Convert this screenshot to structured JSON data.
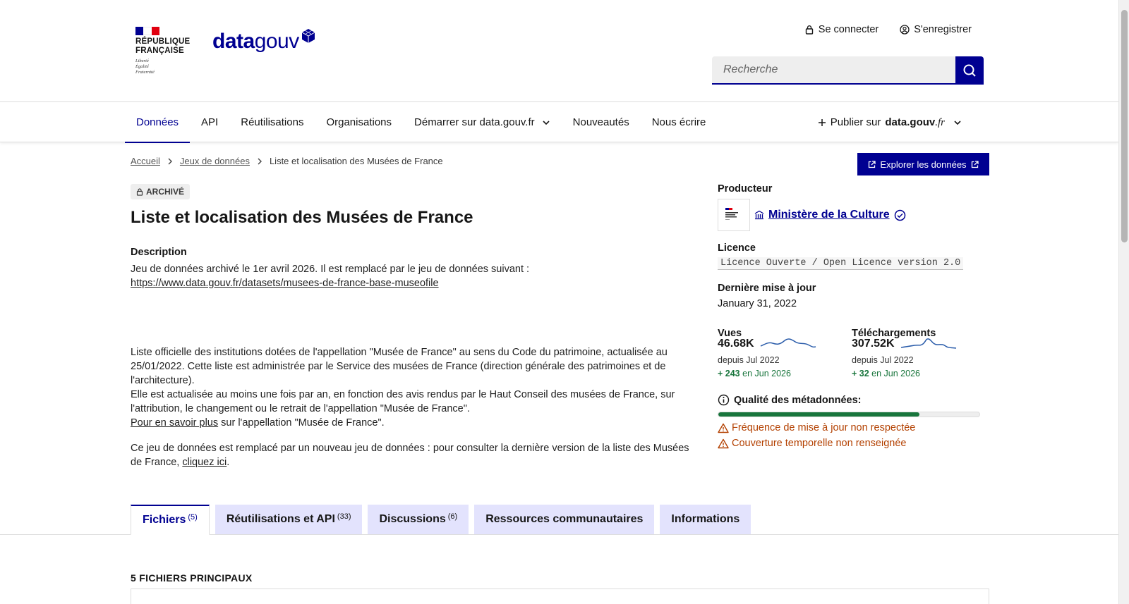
{
  "header": {
    "rf_name_line1": "RÉPUBLIQUE",
    "rf_name_line2": "FRANÇAISE",
    "rf_motto": [
      "Liberté",
      "Égalité",
      "Fraternité"
    ],
    "logo_bold": "data",
    "logo_light": "gouv",
    "login": "Se connecter",
    "register": "S'enregistrer",
    "search_placeholder": "Recherche"
  },
  "nav": {
    "items": [
      "Données",
      "API",
      "Réutilisations",
      "Organisations",
      "Démarrer sur data.gouv.fr",
      "Nouveautés",
      "Nous écrire"
    ],
    "publish_prefix": "Publier sur",
    "publish_bold": "data.gouv",
    "publish_suffix": ".fr"
  },
  "breadcrumb": {
    "home": "Accueil",
    "datasets": "Jeux de données",
    "current": "Liste et localisation des Musées de France"
  },
  "explore_button": "Explorer les données",
  "dataset": {
    "badge": "ARCHIVÉ",
    "title": "Liste et localisation des Musées de France",
    "description_label": "Description",
    "desc_line1": "Jeu de données archivé le 1er avril 2026. Il est remplacé par le jeu de données suivant :",
    "desc_link1": "https://www.data.gouv.fr/datasets/musees-de-france-base-museofile",
    "desc_para2": "Liste officielle des institutions dotées de l'appellation \"Musée de France\" au sens du Code du patrimoine, actualisée au 25/01/2022. Cette liste est administrée par le Service des musées de France (direction générale des patrimoines et de l'architecture).",
    "desc_para3": "Elle est actualisée au moins une fois par an, en fonction des avis rendus par le Haut Conseil des musées de France, sur l'attribution, le changement ou le retrait de l'appellation \"Musée de France\".",
    "desc_more_link": "Pour en savoir plus",
    "desc_more_rest": " sur l'appellation \"Musée de France\".",
    "desc_para4": "Ce jeu de données est remplacé par un nouveau jeu de données : pour consulter la dernière version de la liste des Musées de France, ",
    "desc_here_link": "cliquez ici",
    "desc_para4_end": "."
  },
  "sidebar": {
    "producer_label": "Producteur",
    "producer_name": "Ministère de la Culture",
    "license_label": "Licence",
    "license_value": "Licence Ouverte / Open Licence version 2.0",
    "updated_label": "Dernière mise à jour",
    "updated_value": "January 31, 2022",
    "views_label": "Vues",
    "views_value": "46.68K",
    "views_since": "depuis Jul 2022",
    "views_delta": "+ 243",
    "views_delta_period": " en Jun 2026",
    "downloads_label": "Téléchargements",
    "downloads_value": "307.52K",
    "downloads_since": "depuis Jul 2022",
    "downloads_delta": "+ 32",
    "downloads_delta_period": " en Jun 2026",
    "quality_label": "Qualité des métadonnées:",
    "quality_score": 0.77,
    "warnings": [
      "Fréquence de mise à jour non respectée",
      "Couverture temporelle non renseignée"
    ]
  },
  "tabs": [
    {
      "label": "Fichiers",
      "count": "(5)"
    },
    {
      "label": "Réutilisations et API",
      "count": "(33)"
    },
    {
      "label": "Discussions",
      "count": "(6)"
    },
    {
      "label": "Ressources communautaires",
      "count": ""
    },
    {
      "label": "Informations",
      "count": ""
    }
  ],
  "files_label": "5 FICHIERS PRINCIPAUX",
  "colors": {
    "primary": "#000091",
    "success": "#18753c",
    "warning": "#b34000",
    "tab_bg": "#e3e3fd",
    "flag_blue": "#000091",
    "flag_red": "#e1000f"
  },
  "icons": [
    "lock-icon",
    "user-circle-icon",
    "search-icon",
    "chevron-down-icon",
    "plus-icon",
    "chevron-right-icon",
    "external-link-icon",
    "building-icon",
    "verified-icon",
    "info-icon",
    "warning-icon"
  ]
}
